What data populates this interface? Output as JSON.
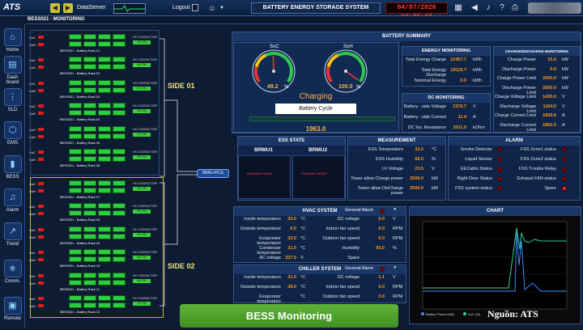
{
  "header": {
    "logo": "ATS",
    "data_server_label": "DataServer",
    "logout_label": "Logout",
    "title": "BATTERY ENERGY STORAGE SYSTEM",
    "datetime": "04/07/2026 19:29:27"
  },
  "subheader": {
    "title": "BESS021 - MONITORING"
  },
  "sidebar": {
    "items": [
      {
        "label": "Home",
        "icon": "home-icon"
      },
      {
        "label": "Dash board",
        "icon": "dashboard-icon"
      },
      {
        "label": "SLD",
        "icon": "sld-icon"
      },
      {
        "label": "EMS",
        "icon": "ems-icon"
      },
      {
        "label": "BESS",
        "icon": "battery-icon"
      },
      {
        "label": "Alarm",
        "icon": "bell-icon"
      },
      {
        "label": "Trend",
        "icon": "trend-icon"
      },
      {
        "label": "Comm.",
        "icon": "network-icon"
      },
      {
        "label": "Remote",
        "icon": "remote-icon"
      }
    ]
  },
  "racks": {
    "soc_label": "SoC",
    "soh_label": "SoH",
    "contactor_label": "HV CONTACTOR",
    "contactor_state": "HV ON",
    "names": [
      "BESS021 - Battery Rack 01",
      "BESS021 - Battery Rack 02",
      "BESS021 - Battery Rack 03",
      "BESS021 - Battery Rack 04",
      "BESS021 - Battery Rack 05",
      "BESS021 - Battery Rack 06",
      "BESS021 - Battery Rack 07",
      "BESS021 - Battery Rack 08",
      "BESS021 - Battery Rack 09",
      "BESS021 - Battery Rack 10",
      "BESS021 - Battery Rack 11",
      "BESS021 - Battery Rack 12"
    ],
    "side1": "SIDE 01",
    "side2": "SIDE 02",
    "pcs": "RMU-PCS"
  },
  "summary": {
    "title": "BATTERY SUMMARY",
    "soc_label": "SoC",
    "soh_label": "SoH",
    "soc_value": "49.2",
    "soh_value": "100.0",
    "soc_unit": "%",
    "soh_unit": "%",
    "soc_gauge": 49.2,
    "soh_gauge": 100,
    "status": "Charging",
    "cycle_label": "Battery Cycle",
    "cycle_value": "1963.0"
  },
  "energy": {
    "title": "ENERGY MONITORING",
    "rows": [
      {
        "label": "Total Energy Charge",
        "value": "12457.7",
        "unit": "kWh"
      },
      {
        "label": "Total Energy Discharge",
        "value": "19119.7",
        "unit": "kWh"
      },
      {
        "label": "Nominal Energy",
        "value": "0.0",
        "unit": "kWh"
      }
    ]
  },
  "dc": {
    "title": "DC MONITORING",
    "rows": [
      {
        "label": "Battery - side Voltage",
        "value": "1376.7",
        "unit": "V"
      },
      {
        "label": "Battery - side Current",
        "value": "11.4",
        "unit": "A"
      },
      {
        "label": "DC Ins. Resistance",
        "value": "2011.0",
        "unit": "kOhm"
      }
    ]
  },
  "chg": {
    "title": "CHARGE/DISCHARGE MONITORING",
    "rows": [
      {
        "label": "Charge Power",
        "value": "15.0",
        "unit": "kW"
      },
      {
        "label": "Discharge Power",
        "value": "0.0",
        "unit": "kW"
      },
      {
        "label": "Charge Power Limit",
        "value": "2500.0",
        "unit": "kW"
      },
      {
        "label": "Discharge Power Limit",
        "value": "2500.0",
        "unit": "kW"
      },
      {
        "label": "Charge Voltage Limit",
        "value": "1435.0",
        "unit": "V"
      },
      {
        "label": "Discharge Voltage Limit",
        "value": "1164.0",
        "unit": "V"
      },
      {
        "label": "Charge Current Limit",
        "value": "1830.6",
        "unit": "A"
      },
      {
        "label": "Discharge Current Limit",
        "value": "1862.5",
        "unit": "A"
      }
    ]
  },
  "ess_state": {
    "title": "ESS STATE",
    "brmu1": "BRMU1",
    "brmu2": "BRMU2",
    "state1": "RUNNING MODE",
    "state2": "RUNNING MODE"
  },
  "measurement": {
    "title": "MEASUREMENT",
    "rows": [
      {
        "label": "ESS Temperature",
        "value": "32.0",
        "unit": "°C"
      },
      {
        "label": "ESS Humidity",
        "value": "65.0",
        "unit": "%"
      },
      {
        "label": "LV Voltage",
        "value": "23.5",
        "unit": "V"
      },
      {
        "label": "Tower allow Charge power",
        "value": "2500.0",
        "unit": "kW"
      },
      {
        "label": "Tower allow DisCharge power",
        "value": "2500.0",
        "unit": "kW"
      }
    ]
  },
  "alarm": {
    "title": "ALARM",
    "left": [
      "Smoke Detector",
      "Liquid Sensor",
      "EECabin Status",
      "Right Door Status",
      "FSS system status"
    ],
    "right": [
      "FSS Zone1 status",
      "FSS Zone2 status",
      "FSS Trouble Relay",
      "Exhaust FAN status",
      "Spare"
    ]
  },
  "hvac": {
    "title": "HVAC SYSTEM",
    "alarm_label": "General Alarm",
    "rows": [
      {
        "l": "Inside temperature",
        "v": "32.0",
        "u": "°C",
        "l2": "DC voltage",
        "v2": "0.0",
        "u2": "V"
      },
      {
        "l": "Outside temperature",
        "v": "0.0",
        "u": "°C",
        "l2": "Indoor fan speed",
        "v2": "0.0",
        "u2": "RPM"
      },
      {
        "l": "Evaporator temperature",
        "v": "33.0",
        "u": "°C",
        "l2": "Outdoor fan speed",
        "v2": "0.0",
        "u2": "RPM"
      },
      {
        "l": "Condenser temperature",
        "v": "31.0",
        "u": "°C",
        "l2": "Humidity",
        "v2": "65.0",
        "u2": "%"
      },
      {
        "l": "AC voltage",
        "v": "227.0",
        "u": "V",
        "l2": "Spare",
        "v2": "",
        "u2": ""
      }
    ]
  },
  "chiller": {
    "title": "CHILLER SYSTEM",
    "alarm_label": "General Alarm",
    "rows": [
      {
        "l": "Inside temperature",
        "v": "31.0",
        "u": "°C",
        "l2": "DC voltage",
        "v2": "1.1",
        "u2": "V"
      },
      {
        "l": "Outside temperature",
        "v": "38.0",
        "u": "°C",
        "l2": "Indoor fan speed",
        "v2": "0.0",
        "u2": "RPM"
      },
      {
        "l": "Evaporator temperature",
        "v": "",
        "u": "°C",
        "l2": "Outdoor fan speed",
        "v2": "0.0",
        "u2": "RPM"
      }
    ]
  },
  "chart": {
    "title": "CHART",
    "legend": [
      "Battery Power (kW)",
      "SoC (%)"
    ]
  },
  "chart_data": {
    "type": "line",
    "title": "CHART",
    "series": [
      {
        "name": "Battery Power (kW)",
        "color": "#3a8bff"
      },
      {
        "name": "SoC (%)",
        "color": "#33d39b"
      }
    ]
  },
  "banner": {
    "text": "BESS Monitoring"
  },
  "source": {
    "text": "Nguồn: ATS"
  },
  "colors": {
    "value": "#ff9b1a",
    "rack_green": "#2ecc40",
    "alarm_red": "#ff2a2a",
    "accent": "#1a3768"
  }
}
